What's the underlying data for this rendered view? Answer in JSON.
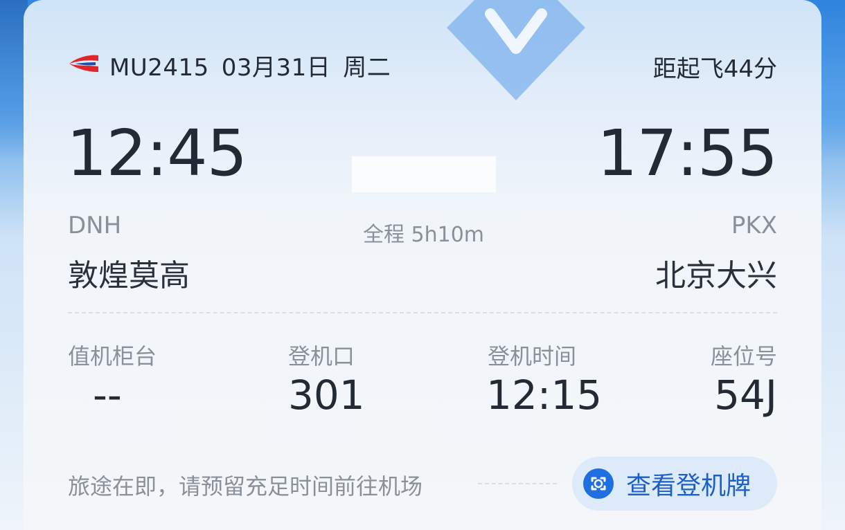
{
  "header": {
    "flight_number": "MU2415",
    "date": "03月31日",
    "weekday": "周二",
    "countdown": "距起飞44分"
  },
  "departure": {
    "time": "12:45",
    "code": "DNH",
    "city": "敦煌莫高"
  },
  "arrival": {
    "time": "17:55",
    "code": "PKX",
    "city": "北京大兴"
  },
  "duration": "全程 5h10m",
  "details": [
    {
      "label": "值机柜台",
      "value": "--"
    },
    {
      "label": "登机口",
      "value": "301"
    },
    {
      "label": "登机时间",
      "value": "12:15"
    },
    {
      "label": "座位号",
      "value": "54J"
    }
  ],
  "footer": {
    "tip": "旅途在即，请预留充足时间前往机场",
    "boarding_pass_button": "查看登机牌"
  },
  "colors": {
    "airline_red": "#e0252b",
    "airline_blue": "#1b4ea8",
    "button_text": "#1c5fc6",
    "button_bg": "#dceaf9"
  },
  "icons": {
    "airline": "china-eastern-logo",
    "boarding_pass": "scan-icon"
  }
}
